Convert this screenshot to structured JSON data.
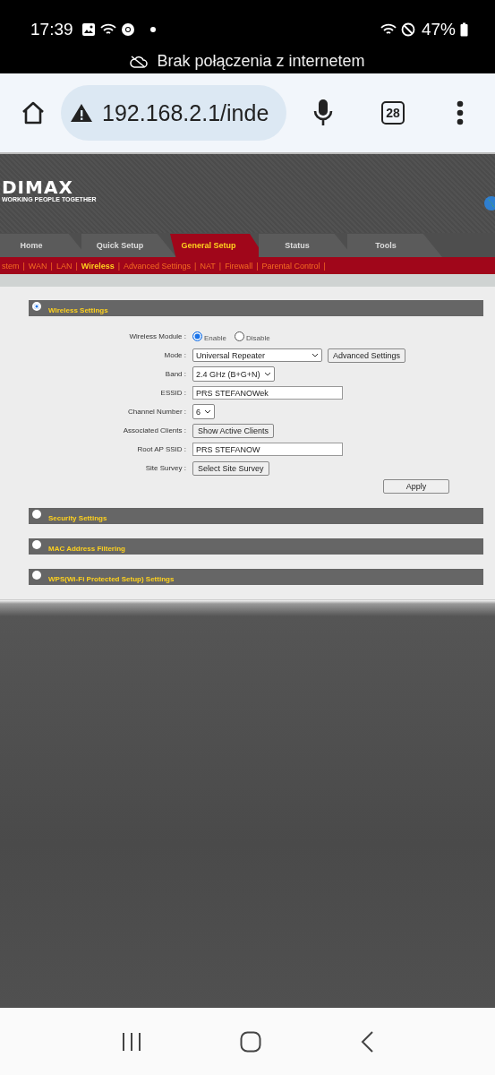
{
  "status_bar": {
    "time": "17:39",
    "battery": "47%",
    "offline_banner": "Brak połączenia z internetem"
  },
  "browser": {
    "url": "192.168.2.1/inde",
    "tab_count": "28"
  },
  "router": {
    "logo": "DIMAX",
    "tagline": "WORKING PEOPLE TOGETHER",
    "tabs": [
      {
        "label": "Home",
        "selected": false
      },
      {
        "label": "Quick Setup",
        "selected": false
      },
      {
        "label": "General Setup",
        "selected": true
      },
      {
        "label": "Status",
        "selected": false
      },
      {
        "label": "Tools",
        "selected": false
      }
    ],
    "subnav": [
      {
        "label": "stem",
        "selected": false,
        "separator": "|"
      },
      {
        "label": "WAN",
        "selected": false,
        "separator": "|"
      },
      {
        "label": "LAN",
        "selected": false,
        "separator": "|"
      },
      {
        "label": "Wireless",
        "selected": true,
        "separator": "|"
      },
      {
        "label": "Advanced Settings",
        "selected": false,
        "separator": "|"
      },
      {
        "label": "NAT",
        "selected": false,
        "separator": "|"
      },
      {
        "label": "Firewall",
        "selected": false,
        "separator": "|"
      },
      {
        "label": "Parental Control",
        "selected": false,
        "separator": "|"
      }
    ],
    "sections": [
      {
        "title": "Wireless Settings",
        "selected": true,
        "rows": [
          {
            "label": "Wireless Module :",
            "kind": "radio",
            "options": [
              {
                "label": "Enable",
                "selected": true
              },
              {
                "label": "Disable",
                "selected": false
              }
            ]
          },
          {
            "label": "Mode :",
            "kind": "select",
            "value": "Universal Repeater",
            "button": "Advanced Settings"
          },
          {
            "label": "Band :",
            "kind": "select",
            "value": "2.4 GHz (B+G+N)"
          },
          {
            "label": "ESSID :",
            "kind": "text",
            "value": "PRS STEFANOWek"
          },
          {
            "label": "Channel Number :",
            "kind": "select",
            "value": "6"
          },
          {
            "label": "Associated Clients :",
            "kind": "button",
            "button": "Show Active Clients"
          },
          {
            "label": "Root AP SSID :",
            "kind": "text",
            "value": "PRS STEFANOW"
          },
          {
            "label": "Site Survey :",
            "kind": "button",
            "button": "Select Site Survey"
          }
        ],
        "apply": "Apply"
      },
      {
        "title": "Security Settings",
        "selected": false
      },
      {
        "title": "MAC Address Filtering",
        "selected": false
      },
      {
        "title": "WPS(Wi-Fi Protected Setup) Settings",
        "selected": false
      }
    ]
  }
}
